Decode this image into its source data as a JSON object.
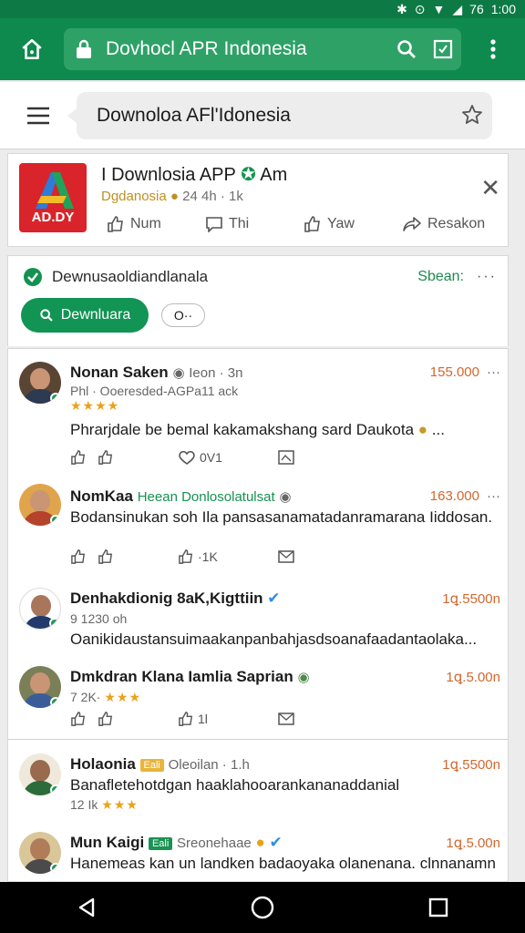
{
  "status_bar": {
    "time": "1:00",
    "battery": "76"
  },
  "browser": {
    "url": "Dovhocl APR Indonesia"
  },
  "search": {
    "query": "Downoloa AFl'Idonesia"
  },
  "app": {
    "logo_text": "AD.DY",
    "title": "I Downlosia APP",
    "title_suffix": "Am",
    "publisher": "Dgdanosia",
    "meta": "24 4h · 1k",
    "actions": [
      {
        "label": "Num",
        "icon": "like-icon"
      },
      {
        "label": "Thi",
        "icon": "comment-icon"
      },
      {
        "label": "Yaw",
        "icon": "share-icon"
      },
      {
        "label": "Resakon",
        "icon": "forward-icon"
      }
    ]
  },
  "download": {
    "status": "Dewnusaoldiandlanala",
    "sort_label": "Sbean:",
    "button_label": "Dewnluara",
    "chip_label": "O··"
  },
  "comments": [
    {
      "name": "Nonan Saken",
      "meta": "Ieon · 3n",
      "right": "155.000",
      "sub": "Phl · Ooeresded-AGPa11 ack",
      "stars": "★★★★",
      "text": "Phrarjdale be bemal kakamakshang sard Daukota",
      "actions": [
        "",
        "",
        "0V1",
        ""
      ],
      "avatar_color": "#5a4434"
    },
    {
      "name": "NomKaa",
      "green": "Heean Donlosolatulsat",
      "right": "163.000",
      "text": "Bodansinukan soh Ila pansasanamatadanramarana Iiddosan.",
      "actions": [
        "",
        "",
        "·1K",
        ""
      ],
      "avatar_color": "#e0a44c"
    },
    {
      "name": "Denhakdionig 8aK,Kigttiin",
      "right": "1ꝗ.5500n",
      "sub": "9 1230 oh",
      "text": "Oanikidaustansuimaakanpanbahjasdsoanafaadantaolaka...",
      "avatar_color": "#ffffff"
    },
    {
      "name": "Dmkdran Klana Ɩamlia Saprian",
      "right": "1ꝗ.5.00n",
      "sub": "7 2K·",
      "stars": "★★★",
      "actions": [
        "",
        "",
        "1l",
        ""
      ],
      "avatar_color": "#7a7f58"
    },
    {
      "name": "Holaonia",
      "tag": "Eali",
      "meta": "Oleoilan · 1.h",
      "right": "1ꝗ.5500n",
      "text": "Banafletehotdgan haaklahooarankananaddanial",
      "sub": "12 Ik",
      "stars": "★★★",
      "avatar_color": "#efe9dc"
    },
    {
      "name": "Mun Kaigi",
      "tag": "Eali",
      "meta": "Sreonehaae",
      "right": "1ꝗ.5.00n",
      "text": "Hanemeas kan un landken badaoyaka olanenana. clnnanamn",
      "avatar_color": "#d9c79a"
    }
  ]
}
